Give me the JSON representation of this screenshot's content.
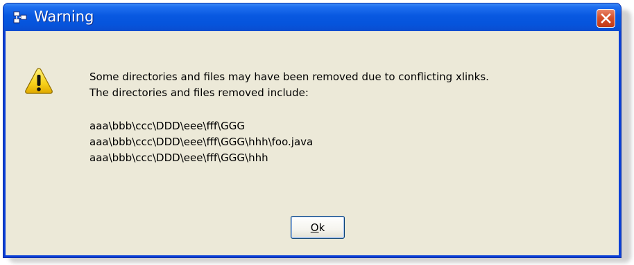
{
  "window": {
    "title": "Warning",
    "close_glyph": "✕",
    "icon": "app-network-icon"
  },
  "dialog": {
    "icon": "warning-icon",
    "message_line1": "Some directories and files may have been removed due to conflicting xlinks.",
    "message_line2": "The directories and files removed include:",
    "paths": [
      "aaa\\bbb\\ccc\\DDD\\eee\\fff\\GGG",
      "aaa\\bbb\\ccc\\DDD\\eee\\fff\\GGG\\hhh\\foo.java",
      "aaa\\bbb\\ccc\\DDD\\eee\\fff\\GGG\\hhh"
    ],
    "ok_mnemonic": "O",
    "ok_rest": "k"
  },
  "colors": {
    "titlebar": "#0654dc",
    "client": "#ece9d8",
    "close": "#c23a17",
    "warning_yellow": "#f7d11a"
  }
}
